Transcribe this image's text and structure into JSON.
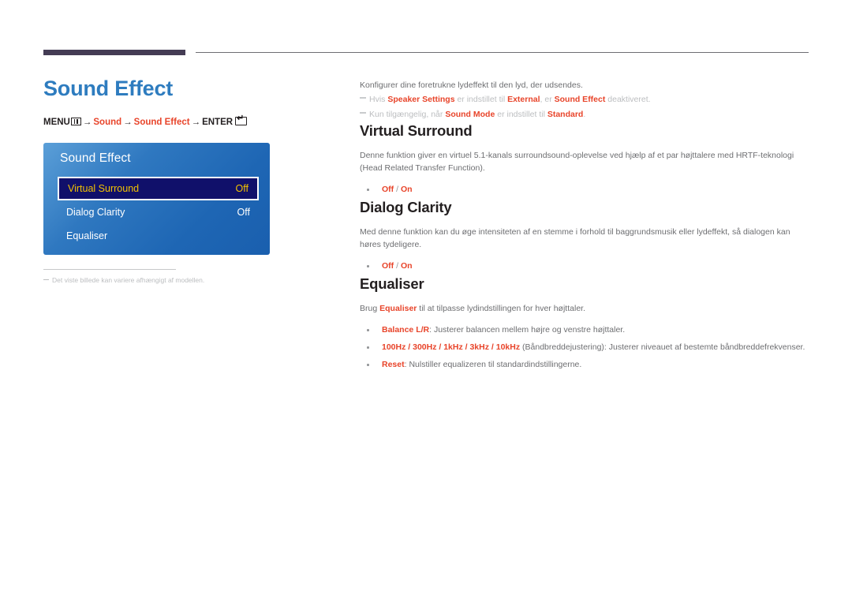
{
  "page": {
    "title": "Sound Effect",
    "menu_path": {
      "menu_label": "MENU",
      "menu_icon": "menu-bars-icon",
      "arrow": "→",
      "step1": "Sound",
      "step2": "Sound Effect",
      "enter_label": "ENTER",
      "enter_icon": "enter-return-icon"
    },
    "footnote": "Det viste billede kan variere afhængigt af modellen."
  },
  "osd": {
    "title": "Sound Effect",
    "rows": [
      {
        "label": "Virtual Surround",
        "value": "Off",
        "selected": true
      },
      {
        "label": "Dialog Clarity",
        "value": "Off",
        "selected": false
      },
      {
        "label": "Equaliser",
        "value": "",
        "selected": false
      }
    ]
  },
  "content": {
    "intro": "Konfigurer dine foretrukne lydeffekt til den lyd, der udsendes.",
    "notes": [
      {
        "p1": "Hvis ",
        "b1": "Speaker Settings",
        "p2": " er indstillet til ",
        "b2": "External",
        "p3": ", er ",
        "b3": "Sound Effect",
        "p4": " deaktiveret."
      },
      {
        "p1": "Kun tilgængelig, når ",
        "b1": "Sound Mode",
        "p2": " er indstillet til ",
        "b2": "Standard",
        "p3": ".",
        "b3": "",
        "p4": ""
      }
    ],
    "sections": [
      {
        "title": "Virtual Surround",
        "body": "Denne funktion giver en virtuel 5.1-kanals surroundsound-oplevelse ved hjælp af et par højttalere med HRTF-teknologi (Head Related Transfer Function).",
        "options": {
          "off": "Off",
          "sep": " / ",
          "on": "On"
        }
      },
      {
        "title": "Dialog Clarity",
        "body": "Med denne funktion kan du øge intensiteten af en stemme i forhold til baggrundsmusik eller lydeffekt, så dialogen kan høres tydeligere.",
        "options": {
          "off": "Off",
          "sep": " / ",
          "on": "On"
        }
      }
    ],
    "equaliser": {
      "title": "Equaliser",
      "body_pre": "Brug ",
      "body_bold": "Equaliser",
      "body_post": " til at tilpasse lydindstillingen for hver højttaler.",
      "bullets": [
        {
          "bold": "Balance L/R",
          "text": ": Justerer balancen mellem højre og venstre højttaler."
        },
        {
          "bold": "100Hz / 300Hz / 1kHz / 3kHz / 10kHz",
          "text": " (Båndbreddejustering): Justerer niveauet af bestemte båndbreddefrekvenser."
        },
        {
          "bold": "Reset",
          "text": ": Nulstiller equalizeren til standardindstillingerne."
        }
      ]
    }
  },
  "colors": {
    "accent_red": "#e8442a",
    "title_blue": "#2e7cbf",
    "osd_blue": "#2f78c0",
    "osd_selected": "#10106a",
    "osd_selected_text": "#f2c200",
    "header_bar": "#443c54"
  }
}
